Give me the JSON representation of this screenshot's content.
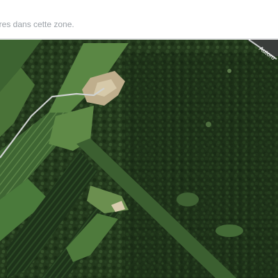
{
  "notice": {
    "text": "taires dans cette zone."
  },
  "map": {
    "view": "satellite",
    "road_label": "Autoro",
    "colors": {
      "forest_dark": "#1f3319",
      "forest_mid": "#2a4423",
      "field_green": "#47703a",
      "field_light": "#5f8a47",
      "clearing_sand": "#c8b998",
      "road": "#d0d3d2"
    }
  }
}
